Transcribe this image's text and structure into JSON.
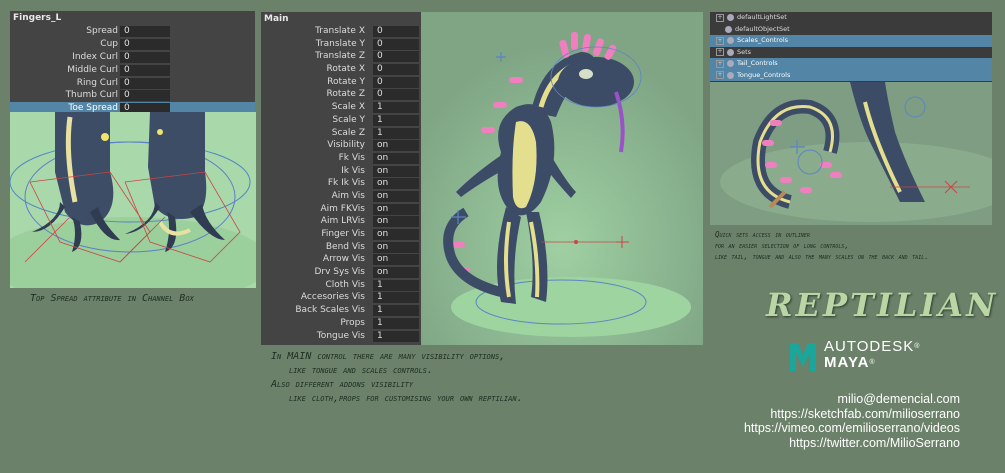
{
  "fingers_panel": {
    "title": "Fingers_L",
    "rows": [
      {
        "label": "Spread",
        "value": "0"
      },
      {
        "label": "Cup",
        "value": "0"
      },
      {
        "label": "Index Curl",
        "value": "0"
      },
      {
        "label": "Middle Curl",
        "value": "0"
      },
      {
        "label": "Ring Curl",
        "value": "0"
      },
      {
        "label": "Thumb Curl",
        "value": "0"
      },
      {
        "label": "Toe Spread",
        "value": "0"
      }
    ]
  },
  "main_panel": {
    "title": "Main",
    "rows": [
      {
        "label": "Translate X",
        "value": "0"
      },
      {
        "label": "Translate Y",
        "value": "0"
      },
      {
        "label": "Translate Z",
        "value": "0"
      },
      {
        "label": "Rotate X",
        "value": "0"
      },
      {
        "label": "Rotate Y",
        "value": "0"
      },
      {
        "label": "Rotate Z",
        "value": "0"
      },
      {
        "label": "Scale X",
        "value": "1"
      },
      {
        "label": "Scale Y",
        "value": "1"
      },
      {
        "label": "Scale Z",
        "value": "1"
      },
      {
        "label": "Visibility",
        "value": "on"
      },
      {
        "label": "Fk Vis",
        "value": "on"
      },
      {
        "label": "Ik Vis",
        "value": "on"
      },
      {
        "label": "Fk Ik Vis",
        "value": "on"
      },
      {
        "label": "Aim Vis",
        "value": "on"
      },
      {
        "label": "Aim FKVis",
        "value": "on"
      },
      {
        "label": "Aim LRVis",
        "value": "on"
      },
      {
        "label": "Finger Vis",
        "value": "on"
      },
      {
        "label": "Bend Vis",
        "value": "on"
      },
      {
        "label": "Arrow Vis",
        "value": "on"
      },
      {
        "label": "Drv Sys Vis",
        "value": "on"
      },
      {
        "label": "Cloth Vis",
        "value": "1"
      },
      {
        "label": "Accesories Vis",
        "value": "1"
      },
      {
        "label": "Back Scales Vis",
        "value": "1"
      },
      {
        "label": "Props",
        "value": "1"
      },
      {
        "label": "Tongue Vis",
        "value": "1"
      }
    ]
  },
  "outliner": {
    "rows": [
      {
        "label": "defaultLightSet",
        "expand": "+"
      },
      {
        "label": "defaultObjectSet",
        "expand": ""
      },
      {
        "label": "Scales_Controls",
        "expand": "+"
      },
      {
        "label": "Sets",
        "expand": "+"
      },
      {
        "label": "Tail_Controls",
        "expand": "+"
      },
      {
        "label": "Tongue_Controls",
        "expand": "+"
      }
    ]
  },
  "captions": {
    "fingers": "Top Spread attribute in Channel Box",
    "main_1": "In MAIN control there are many visibility options,",
    "main_2": "like tongue and scales controls.",
    "main_3": "Also different addons visibility",
    "main_4": "like cloth,props for customising your own reptilian.",
    "sets_1": "Quick sets access in outliner",
    "sets_2": "for an easier selection of long controls,",
    "sets_3": "like tail, tongue and also the many scales on the back and tail."
  },
  "title": "REPTILIAN",
  "brand": {
    "line1": "AUTODESK",
    "line2": "MAYA",
    "mark": "®"
  },
  "contacts": [
    "milio@demencial.com",
    "https://sketchfab.com/milioserrano",
    "https://vimeo.com/emilioserrano/videos",
    "https://twitter.com/MilioSerrano"
  ],
  "colors": {
    "background": "#6b8169",
    "panel": "#444444",
    "selected": "#5285a6",
    "title": "#b9d6a4"
  }
}
